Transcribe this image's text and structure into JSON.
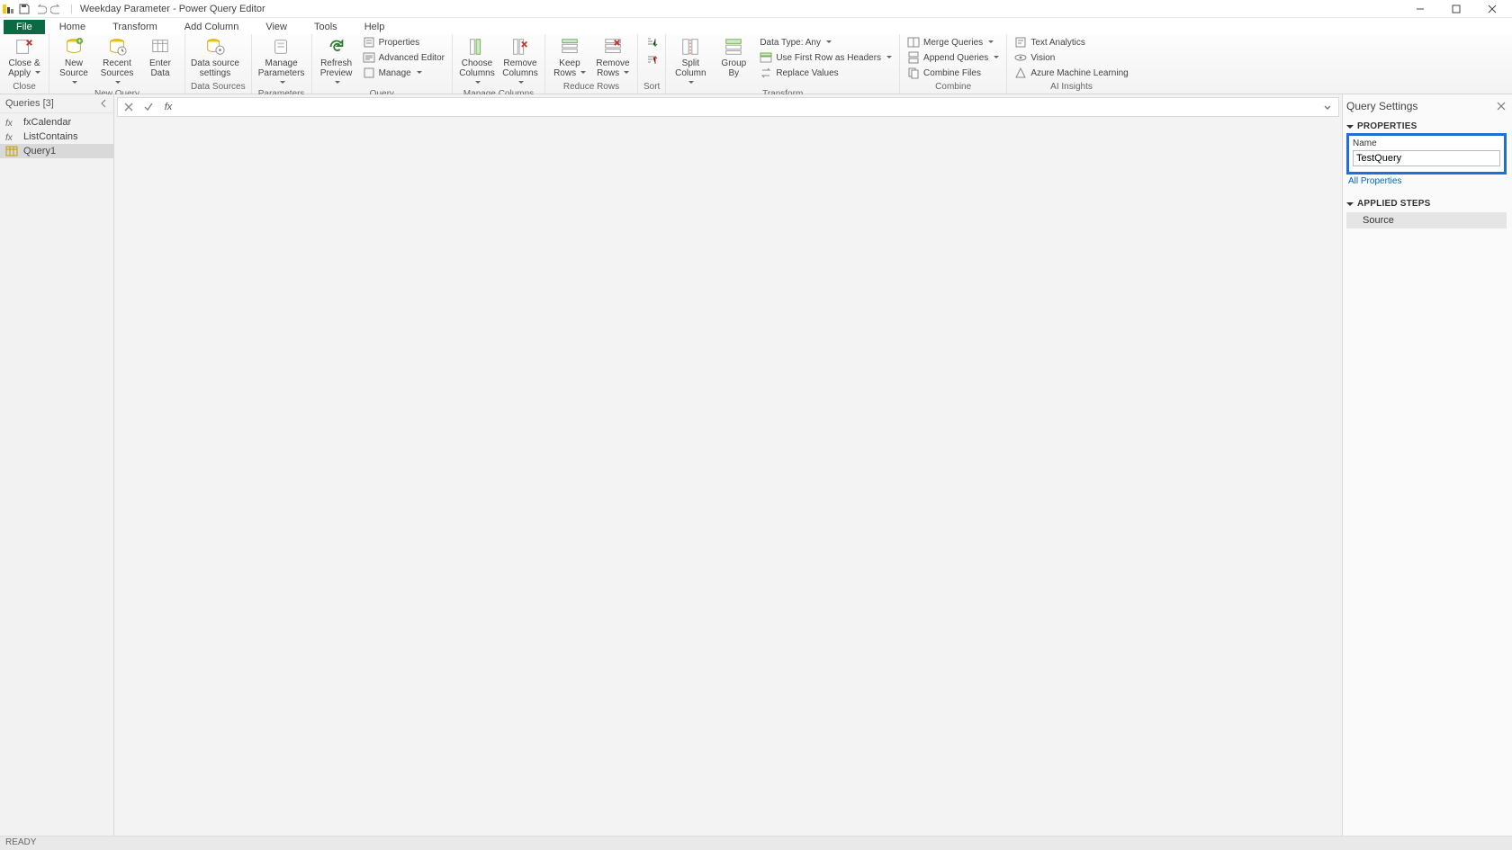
{
  "titlebar": {
    "title": "Weekday Parameter - Power Query Editor"
  },
  "tabs": {
    "file": "File",
    "home": "Home",
    "transform": "Transform",
    "add_column": "Add Column",
    "view": "View",
    "tools": "Tools",
    "help": "Help"
  },
  "ribbon": {
    "close": {
      "close_apply": "Close &",
      "apply": "Apply",
      "group": "Close"
    },
    "new_query": {
      "new_source": "New",
      "source": "Source",
      "recent_sources": "Recent",
      "sources": "Sources",
      "enter_data": "Enter",
      "data": "Data",
      "group": "New Query"
    },
    "data_sources": {
      "data_source": "Data source",
      "settings": "settings",
      "group": "Data Sources"
    },
    "parameters": {
      "manage_parameters": "Manage",
      "parameters": "Parameters",
      "group": "Parameters"
    },
    "query": {
      "refresh_preview": "Refresh",
      "preview": "Preview",
      "properties": "Properties",
      "advanced_editor": "Advanced Editor",
      "manage": "Manage",
      "group": "Query"
    },
    "manage_columns": {
      "choose_columns": "Choose",
      "columns": "Columns",
      "remove_columns": "Remove",
      "group": "Manage Columns"
    },
    "reduce_rows": {
      "keep_rows": "Keep",
      "rows": "Rows",
      "remove_rows": "Remove",
      "group": "Reduce Rows"
    },
    "sort": {
      "group": "Sort"
    },
    "transform": {
      "split_column": "Split",
      "column": "Column",
      "group_by": "Group",
      "by": "By",
      "data_type": "Data Type: Any",
      "first_row_headers": "Use First Row as Headers",
      "replace_values": "Replace Values",
      "group": "Transform"
    },
    "combine": {
      "merge_queries": "Merge Queries",
      "append_queries": "Append Queries",
      "combine_files": "Combine Files",
      "group": "Combine"
    },
    "ai": {
      "text_analytics": "Text Analytics",
      "vision": "Vision",
      "azure_ml": "Azure Machine Learning",
      "group": "AI Insights"
    }
  },
  "queries": {
    "header": "Queries [3]",
    "items": [
      {
        "name": "fxCalendar",
        "icon": "function"
      },
      {
        "name": "ListContains",
        "icon": "function"
      },
      {
        "name": "Query1",
        "icon": "table",
        "selected": true
      }
    ]
  },
  "formula_bar": {
    "value": ""
  },
  "settings": {
    "title": "Query Settings",
    "properties_label": "PROPERTIES",
    "name_label": "Name",
    "name_value": "TestQuery",
    "all_properties": "All Properties",
    "applied_steps_label": "APPLIED STEPS",
    "steps": [
      "Source"
    ]
  },
  "statusbar": {
    "ready": "READY"
  }
}
